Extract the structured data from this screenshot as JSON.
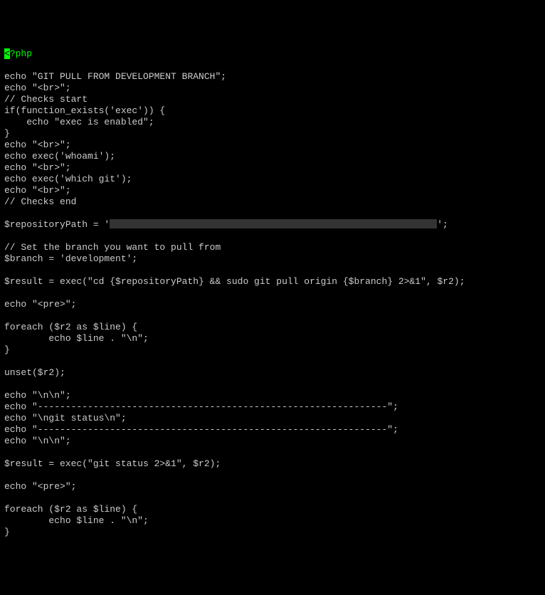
{
  "php_open": {
    "bracket": "<",
    "tag": "?php"
  },
  "lines": [
    "",
    "echo \"GIT PULL FROM DEVELOPMENT BRANCH\";",
    "echo \"<br>\";",
    "// Checks start",
    "if(function_exists('exec')) {",
    "    echo \"exec is enabled\";",
    "}",
    "echo \"<br>\";",
    "echo exec('whoami');",
    "echo \"<br>\";",
    "echo exec('which git');",
    "echo \"<br>\";",
    "// Checks end",
    "",
    {
      "type": "repo",
      "prefix": "$repositoryPath = '",
      "suffix": "';"
    },
    "",
    "// Set the branch you want to pull from",
    "$branch = 'development';",
    "",
    "$result = exec(\"cd {$repositoryPath} && sudo git pull origin {$branch} 2>&1\", $r2);",
    "",
    "echo \"<pre>\";",
    "",
    "foreach ($r2 as $line) {",
    "        echo $line . \"\\n\";",
    "}",
    "",
    "unset($r2);",
    "",
    "echo \"\\n\\n\";",
    "echo \"---------------------------------------------------------------\";",
    "echo \"\\ngit status\\n\";",
    "echo \"---------------------------------------------------------------\";",
    "echo \"\\n\\n\";",
    "",
    "$result = exec(\"git status 2>&1\", $r2);",
    "",
    "echo \"<pre>\";",
    "",
    "foreach ($r2 as $line) {",
    "        echo $line . \"\\n\";",
    "}"
  ]
}
